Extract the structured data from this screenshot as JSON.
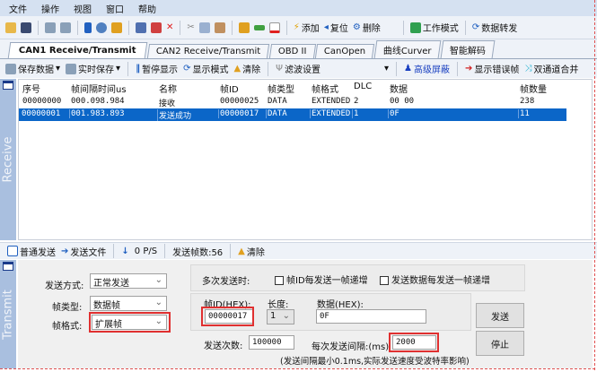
{
  "menu": [
    "文件",
    "操作",
    "视图",
    "窗口",
    "帮助"
  ],
  "toolbar": {
    "add": "添加",
    "reset": "复位",
    "delete": "删除",
    "work_mode": "工作模式",
    "data_forward": "数据转发"
  },
  "tabs": [
    "CAN1 Receive/Transmit",
    "CAN2 Receive/Transmit",
    "OBD II",
    "CanOpen",
    "曲线Curver",
    "智能解码"
  ],
  "subbar": {
    "save_data": "保存数据",
    "realtime_save": "实时保存",
    "pause": "暂停显示",
    "display_mode": "显示模式",
    "clear": "清除",
    "filter": "滤波设置",
    "advanced_mask": "高级屏蔽",
    "show_error": "显示错误帧",
    "merge": "双通道合并"
  },
  "receive_label": "Receive",
  "grid": {
    "columns": [
      "序号",
      "帧间隔时间us",
      "名称",
      "帧ID",
      "帧类型",
      "帧格式",
      "DLC",
      "数据",
      "帧数量"
    ],
    "rows": [
      [
        "00000000",
        "000.098.984",
        "接收",
        "00000025",
        "DATA",
        "EXTENDED",
        "2",
        "00 00",
        "238"
      ],
      [
        "00000001",
        "001.983.893",
        "发送成功",
        "00000017",
        "DATA",
        "EXTENDED",
        "1",
        "0F",
        "11"
      ]
    ],
    "selected_row": 1
  },
  "bottombar": {
    "normal_send": "普通发送",
    "send_file": "发送文件",
    "rate": "0 P/S",
    "sent_count": "发送帧数:56",
    "clear": "清除"
  },
  "transmit": {
    "label": "Transmit",
    "send_mode_label": "发送方式:",
    "send_mode": "正常发送",
    "frame_type_label": "帧类型:",
    "frame_type": "数据帧",
    "frame_format_label": "帧格式:",
    "frame_format": "扩展帧",
    "multi_label": "多次发送时:",
    "id_increment": "帧ID每发送一帧递增",
    "data_increment": "发送数据每发送一帧递增",
    "id_label": "帧ID(HEX):",
    "id_value": "00000017",
    "length_label": "长度:",
    "length_value": "1",
    "data_label": "数据(HEX):",
    "data_value": "0F",
    "count_label": "发送次数:",
    "count_value": "100000",
    "interval_label": "每次发送间隔:(ms)",
    "interval_value": "2000",
    "note": "(发送间隔最小0.1ms,实际发送速度受波特率影响)",
    "send_button": "发送",
    "stop_button": "停止"
  }
}
